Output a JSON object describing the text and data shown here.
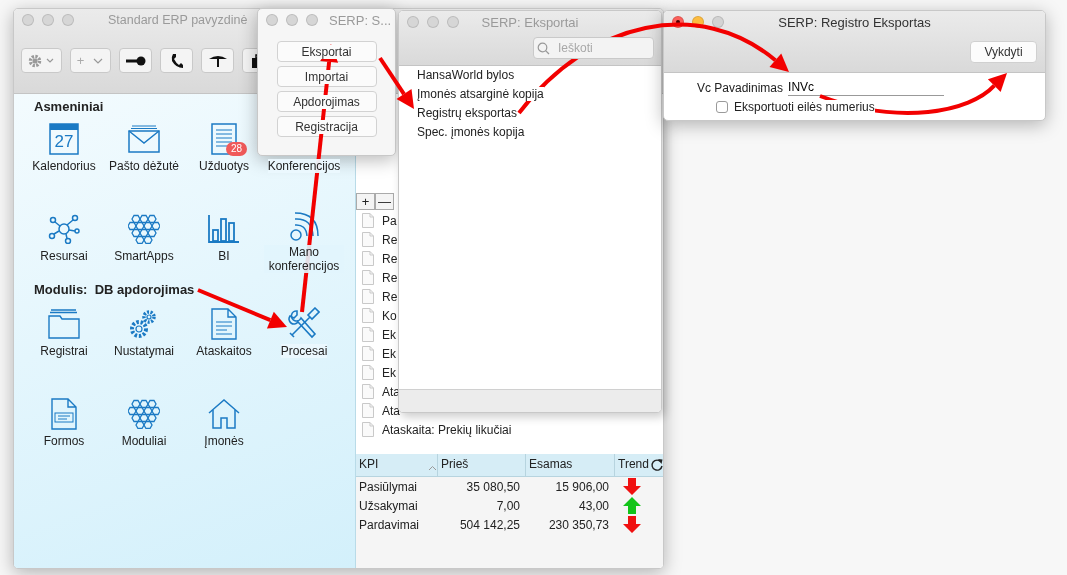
{
  "main_window": {
    "title": "Standard ERP pavyzdinė",
    "active": false,
    "toolbar": [
      {
        "kind": "gear-menu"
      },
      {
        "kind": "add-menu",
        "label": "+"
      },
      {
        "kind": "key"
      },
      {
        "kind": "phone"
      },
      {
        "kind": "antenna"
      },
      {
        "kind": "briefcase"
      }
    ],
    "sections": [
      {
        "heading": "Asmeniniai",
        "items": [
          {
            "label": "Kalendorius",
            "kind": "calendar",
            "date": "27"
          },
          {
            "label": "Pašto dėžutė",
            "kind": "mail"
          },
          {
            "label": "Užduotys",
            "kind": "tasks",
            "badge": "28"
          },
          {
            "label": "Konferencijos",
            "kind": "hidden"
          },
          {
            "label": "Resursai",
            "kind": "network"
          },
          {
            "label": "SmartApps",
            "kind": "hexagons"
          },
          {
            "label": "BI",
            "kind": "chart"
          },
          {
            "label": "Mano konferencijos",
            "kind": "broadcast"
          }
        ]
      },
      {
        "heading": "Modulis:  DB apdorojimas",
        "items": [
          {
            "label": "Registrai",
            "kind": "folder"
          },
          {
            "label": "Nustatymai",
            "kind": "gears"
          },
          {
            "label": "Ataskaitos",
            "kind": "report"
          },
          {
            "label": "Procesai",
            "kind": "tools"
          },
          {
            "label": "Formos",
            "kind": "form"
          },
          {
            "label": "Moduliai",
            "kind": "hexagons"
          },
          {
            "label": "Įmonės",
            "kind": "house"
          }
        ]
      }
    ],
    "list_buttons": [
      "+",
      "—"
    ],
    "records": [
      "Pa",
      "Re",
      "Re",
      "Re",
      "Re",
      "Ko",
      "Ek",
      "Ek",
      "Ek",
      "Ata",
      "Ata",
      "Ataskaita: Prekių likučiai"
    ],
    "kpi_table": {
      "columns": [
        "KPI",
        "Prieš",
        "Esamas",
        "Trend"
      ],
      "rows": [
        {
          "kpi": "Pasiūlymai",
          "before": "35 080,50",
          "current": "15 906,00",
          "kind": "down"
        },
        {
          "kpi": "Užsakymai",
          "before": "7,00",
          "current": "43,00",
          "kind": "up"
        },
        {
          "kpi": "Pardavimai",
          "before": "504 142,25",
          "current": "230 350,73",
          "kind": "down"
        }
      ]
    }
  },
  "menu_window": {
    "title": "SERP: S...",
    "active": false,
    "buttons": [
      "Eksportai",
      "Importai",
      "Apdorojimas",
      "Registracija"
    ]
  },
  "exports_window": {
    "title": "SERP: Eksportai",
    "active": false,
    "search": {
      "placeholder": "Ieškoti"
    },
    "items": [
      "HansaWorld bylos",
      "Įmonės atsarginė kopija",
      "Registrų eksportas",
      "Spec. įmonės kopija"
    ]
  },
  "register_window": {
    "title": "SERP: Registro Eksportas",
    "active": true,
    "button": "Vykdyti",
    "field": {
      "label": "Vc Pavadinimas",
      "value": "INVc"
    },
    "checkbox": {
      "label": "Eksportuoti eilės numerius",
      "checked": false
    }
  }
}
